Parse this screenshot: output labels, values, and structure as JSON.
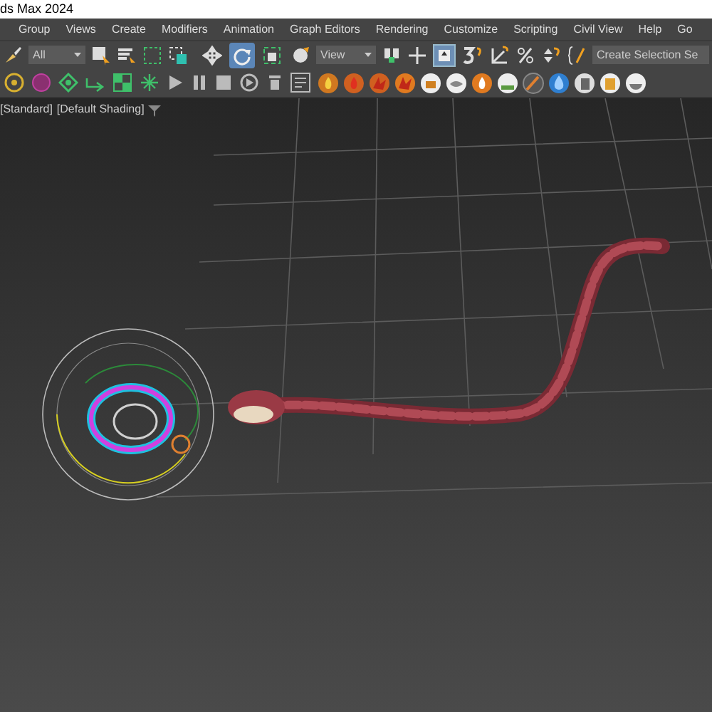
{
  "window": {
    "title": "ds Max 2024"
  },
  "menu": [
    {
      "label": "Group"
    },
    {
      "label": "Views"
    },
    {
      "label": "Create"
    },
    {
      "label": "Modifiers"
    },
    {
      "label": "Animation"
    },
    {
      "label": "Graph Editors"
    },
    {
      "label": "Rendering"
    },
    {
      "label": "Customize"
    },
    {
      "label": "Scripting"
    },
    {
      "label": "Civil View"
    },
    {
      "label": "Help"
    },
    {
      "label": "Go"
    }
  ],
  "toolbar": {
    "selection_filter": "All",
    "reference_coordinate_system": "View",
    "named_selection_set": "Create Selection Se",
    "transform_tools": [
      {
        "kind": "move",
        "selected": false
      },
      {
        "kind": "rotate",
        "selected": true
      },
      {
        "kind": "scale",
        "selected": false
      }
    ]
  },
  "viewport": {
    "labels": [
      "[Standard]",
      "[Default Shading]"
    ]
  }
}
